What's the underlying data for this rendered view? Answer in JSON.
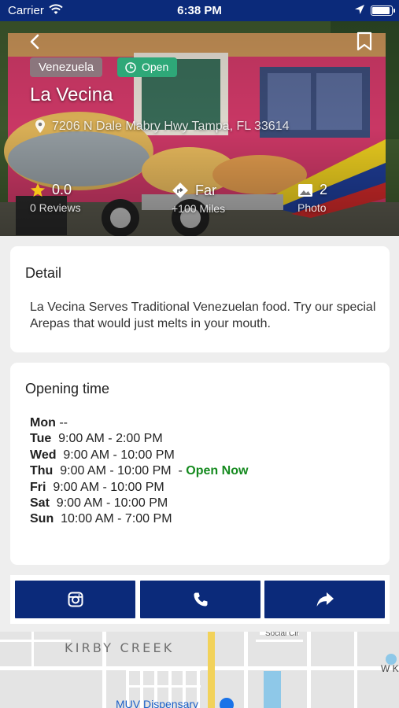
{
  "status_bar": {
    "carrier": "Carrier",
    "time": "6:38 PM"
  },
  "listing": {
    "category": "Venezuela",
    "open_status": "Open",
    "name": "La Vecina",
    "address": "7206 N Dale Mabry Hwy Tampa, FL 33614",
    "rating": "0.0",
    "reviews": "0 Reviews",
    "distance": "Far",
    "distance_sub": "+100 Miles",
    "photos": "2",
    "photos_label": "Photo"
  },
  "detail": {
    "heading": "Detail",
    "text": "La Vecina Serves Traditional Venezuelan food. Try our special Arepas that would just melts in your mouth."
  },
  "opening": {
    "heading": "Opening time",
    "hours": [
      {
        "day": "Mon",
        "time": " --",
        "note": ""
      },
      {
        "day": "Tue",
        "time": "9:00 AM - 2:00 PM",
        "note": ""
      },
      {
        "day": "Wed",
        "time": "9:00 AM - 10:00 PM",
        "note": ""
      },
      {
        "day": "Thu",
        "time": "9:00 AM - 10:00 PM",
        "note": "Open Now"
      },
      {
        "day": "Fri",
        "time": "9:00 AM - 10:00 PM",
        "note": ""
      },
      {
        "day": "Sat",
        "time": "9:00 AM - 10:00 PM",
        "note": ""
      },
      {
        "day": "Sun",
        "time": "10:00 AM - 7:00 PM",
        "note": ""
      }
    ]
  },
  "actions": [
    {
      "icon": "instagram-icon"
    },
    {
      "icon": "phone-icon"
    },
    {
      "icon": "share-icon"
    }
  ],
  "map": {
    "area_label": "KIRBY CREEK",
    "street_label": "Social Cir",
    "poi_label": "MUV Dispensary",
    "edge_label": "W K"
  },
  "colors": {
    "brand": "#0b2a7a",
    "open_badge": "#2ea878",
    "open_now": "#158a1f"
  }
}
